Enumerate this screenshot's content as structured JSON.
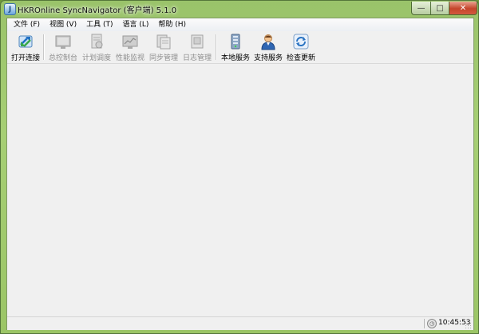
{
  "window": {
    "title": "HKROnline SyncNavigator (客户端) 5.1.0",
    "app_icon_glyph": "J",
    "controls": {
      "minimize": "—",
      "maximize": "□",
      "close": "✕"
    }
  },
  "menu": [
    {
      "id": "file",
      "label": "文件 (F)"
    },
    {
      "id": "view",
      "label": "视图 (V)"
    },
    {
      "id": "tools",
      "label": "工具 (T)"
    },
    {
      "id": "language",
      "label": "语言 (L)"
    },
    {
      "id": "help",
      "label": "帮助 (H)"
    }
  ],
  "toolbar": [
    {
      "id": "open-connection",
      "label": "打开连接",
      "icon": "connect-arrows-icon",
      "enabled": true
    },
    {
      "id": "console",
      "label": "总控制台",
      "icon": "monitor-icon",
      "enabled": false
    },
    {
      "id": "schedule",
      "label": "计划调度",
      "icon": "schedule-doc-icon",
      "enabled": false
    },
    {
      "id": "performance",
      "label": "性能监视",
      "icon": "chart-monitor-icon",
      "enabled": false
    },
    {
      "id": "sync-manage",
      "label": "同步管理",
      "icon": "sync-doc-icon",
      "enabled": false
    },
    {
      "id": "log-manage",
      "label": "日志管理",
      "icon": "log-doc-icon",
      "enabled": false
    },
    {
      "id": "local-service",
      "label": "本地服务",
      "icon": "server-icon",
      "enabled": true
    },
    {
      "id": "support-service",
      "label": "支持服务",
      "icon": "support-person-icon",
      "enabled": true
    },
    {
      "id": "check-update",
      "label": "检查更新",
      "icon": "refresh-icon",
      "enabled": true
    }
  ],
  "status": {
    "time": "10:45:53"
  }
}
